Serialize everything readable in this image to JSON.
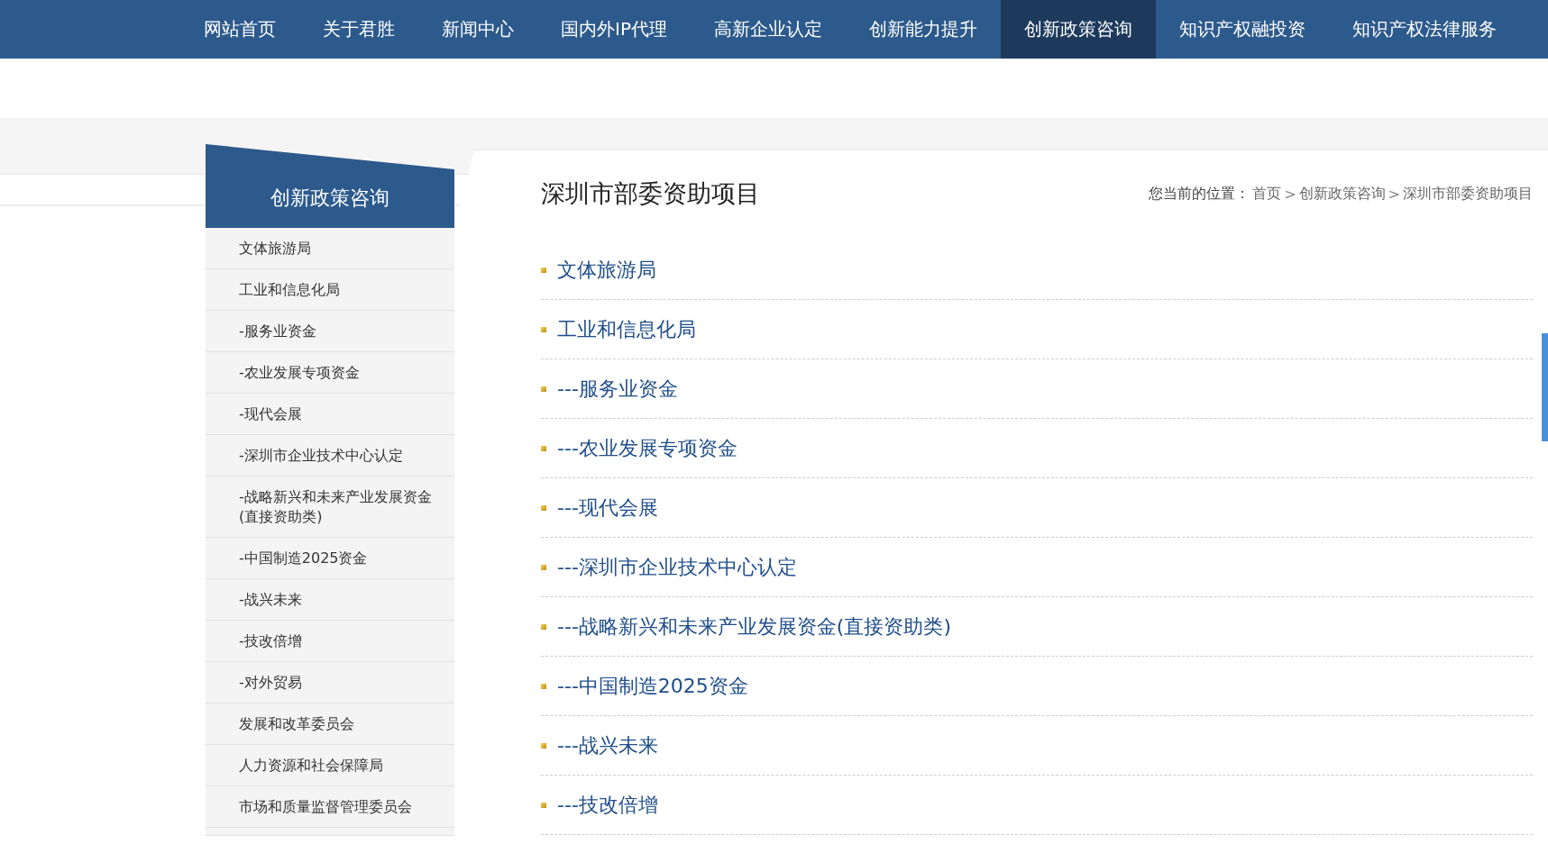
{
  "nav": [
    {
      "label": "网站首页",
      "selected": false
    },
    {
      "label": "关于君胜",
      "selected": false
    },
    {
      "label": "新闻中心",
      "selected": false
    },
    {
      "label": "国内外IP代理",
      "selected": false
    },
    {
      "label": "高新企业认定",
      "selected": false
    },
    {
      "label": "创新能力提升",
      "selected": false
    },
    {
      "label": "创新政策咨询",
      "selected": true
    },
    {
      "label": "知识产权融投资",
      "selected": false
    },
    {
      "label": "知识产权法律服务",
      "selected": false
    }
  ],
  "sidebar": {
    "title": "创新政策咨询",
    "items": [
      "文体旅游局",
      "工业和信息化局",
      "-服务业资金",
      "-农业发展专项资金",
      "-现代会展",
      "-深圳市企业技术中心认定",
      "-战略新兴和未来产业发展资金(直接资助类)",
      "-中国制造2025资金",
      "-战兴未来",
      "-技改倍增",
      "-对外贸易",
      "发展和改革委员会",
      "人力资源和社会保障局",
      "市场和质量监督管理委员会"
    ]
  },
  "content": {
    "title": "深圳市部委资助项目",
    "breadcrumb": [
      {
        "kind": "label",
        "text": "您当前的位置："
      },
      {
        "kind": "link",
        "text": "首页"
      },
      {
        "kind": "separator",
        "text": ">"
      },
      {
        "kind": "link",
        "text": "创新政策咨询"
      },
      {
        "kind": "separator",
        "text": ">"
      },
      {
        "kind": "link",
        "text": "深圳市部委资助项目"
      }
    ],
    "list": [
      "文体旅游局",
      "工业和信息化局",
      "---服务业资金",
      "---农业发展专项资金",
      "---现代会展",
      "---深圳市企业技术中心认定",
      "---战略新兴和未来产业发展资金(直接资助类)",
      "---中国制造2025资金",
      "---战兴未来",
      "---技改倍增"
    ]
  }
}
